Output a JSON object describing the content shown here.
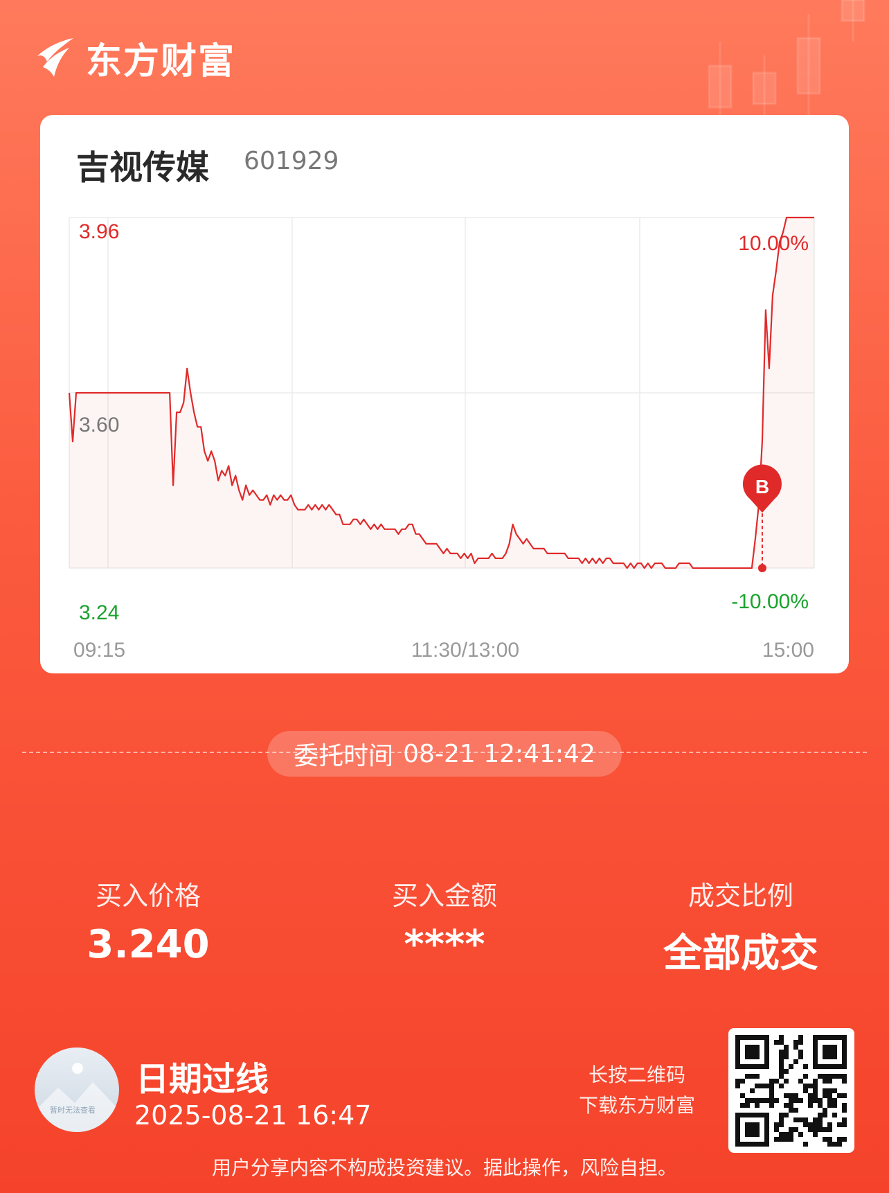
{
  "brand": {
    "name": "东方财富",
    "logo_icon": "eastmoney-logo-icon"
  },
  "stock": {
    "name": "吉视传媒",
    "code": "601929"
  },
  "chart_data": {
    "type": "line",
    "x_labels": [
      "09:15",
      "11:30/13:00",
      "15:00"
    ],
    "y_labels": {
      "top": "3.96",
      "mid": "3.60",
      "bottom": "3.24"
    },
    "pct_labels": {
      "top": "10.00%",
      "bottom": "-10.00%"
    },
    "ylim": [
      3.24,
      3.96
    ],
    "grid": true,
    "series": [
      {
        "values": [
          3.6,
          3.5,
          3.6,
          3.6,
          3.6,
          3.6,
          3.6,
          3.6,
          3.6,
          3.6,
          3.6,
          3.6,
          3.6,
          3.6,
          3.6,
          3.6,
          3.6,
          3.6,
          3.6,
          3.6,
          3.6,
          3.6,
          3.6,
          3.6,
          3.6,
          3.6,
          3.6,
          3.6,
          3.6,
          3.6,
          3.41,
          3.56,
          3.56,
          3.58,
          3.65,
          3.6,
          3.56,
          3.53,
          3.53,
          3.48,
          3.46,
          3.48,
          3.46,
          3.42,
          3.44,
          3.43,
          3.45,
          3.41,
          3.43,
          3.4,
          3.38,
          3.41,
          3.39,
          3.4,
          3.39,
          3.38,
          3.38,
          3.39,
          3.37,
          3.39,
          3.38,
          3.39,
          3.38,
          3.38,
          3.39,
          3.37,
          3.36,
          3.36,
          3.36,
          3.37,
          3.36,
          3.37,
          3.36,
          3.37,
          3.36,
          3.37,
          3.36,
          3.35,
          3.35,
          3.33,
          3.33,
          3.33,
          3.34,
          3.34,
          3.33,
          3.34,
          3.33,
          3.32,
          3.33,
          3.32,
          3.33,
          3.32,
          3.32,
          3.32,
          3.32,
          3.31,
          3.32,
          3.32,
          3.33,
          3.33,
          3.31,
          3.31,
          3.3,
          3.29,
          3.29,
          3.29,
          3.29,
          3.28,
          3.27,
          3.28,
          3.27,
          3.27,
          3.27,
          3.26,
          3.27,
          3.26,
          3.27,
          3.25,
          3.26,
          3.26,
          3.26,
          3.26,
          3.27,
          3.26,
          3.26,
          3.26,
          3.27,
          3.29,
          3.33,
          3.31,
          3.3,
          3.29,
          3.3,
          3.29,
          3.28,
          3.28,
          3.28,
          3.28,
          3.27,
          3.27,
          3.27,
          3.27,
          3.27,
          3.27,
          3.26,
          3.26,
          3.26,
          3.26,
          3.25,
          3.26,
          3.25,
          3.26,
          3.25,
          3.26,
          3.25,
          3.26,
          3.26,
          3.25,
          3.25,
          3.25,
          3.25,
          3.24,
          3.25,
          3.24,
          3.25,
          3.25,
          3.24,
          3.25,
          3.24,
          3.25,
          3.25,
          3.25,
          3.24,
          3.24,
          3.24,
          3.24,
          3.25,
          3.25,
          3.25,
          3.25,
          3.24,
          3.24,
          3.24,
          3.24,
          3.24,
          3.24,
          3.24,
          3.24,
          3.24,
          3.24,
          3.24,
          3.24,
          3.24,
          3.24,
          3.24,
          3.24,
          3.24,
          3.24,
          3.3,
          3.37,
          3.5,
          3.77,
          3.65,
          3.8,
          3.85,
          3.91,
          3.93,
          3.96,
          3.96,
          3.96,
          3.96,
          3.96,
          3.96,
          3.96,
          3.96,
          3.96
        ]
      }
    ],
    "marker": {
      "label": "B",
      "price": 3.24,
      "index": 200
    }
  },
  "order": {
    "time_label": "委托时间",
    "time_value": "08-21 12:41:42"
  },
  "stats": [
    {
      "label": "买入价格",
      "value": "3.240"
    },
    {
      "label": "买入金额",
      "value": "****"
    },
    {
      "label": "成交比例",
      "value": "全部成交"
    }
  ],
  "user": {
    "name": "日期过线",
    "datetime": "2025-08-21 16:47",
    "avatar_caption": "暂时无法查看"
  },
  "qr": {
    "hint_line1": "长按二维码",
    "hint_line2": "下载东方财富",
    "icon": "qr-code-icon"
  },
  "disclaimer": "用户分享内容不构成投资建议。据此操作，风险自担。",
  "colors": {
    "up": "#e02a2a",
    "down": "#1aa32e",
    "line": "#e02a2a"
  }
}
